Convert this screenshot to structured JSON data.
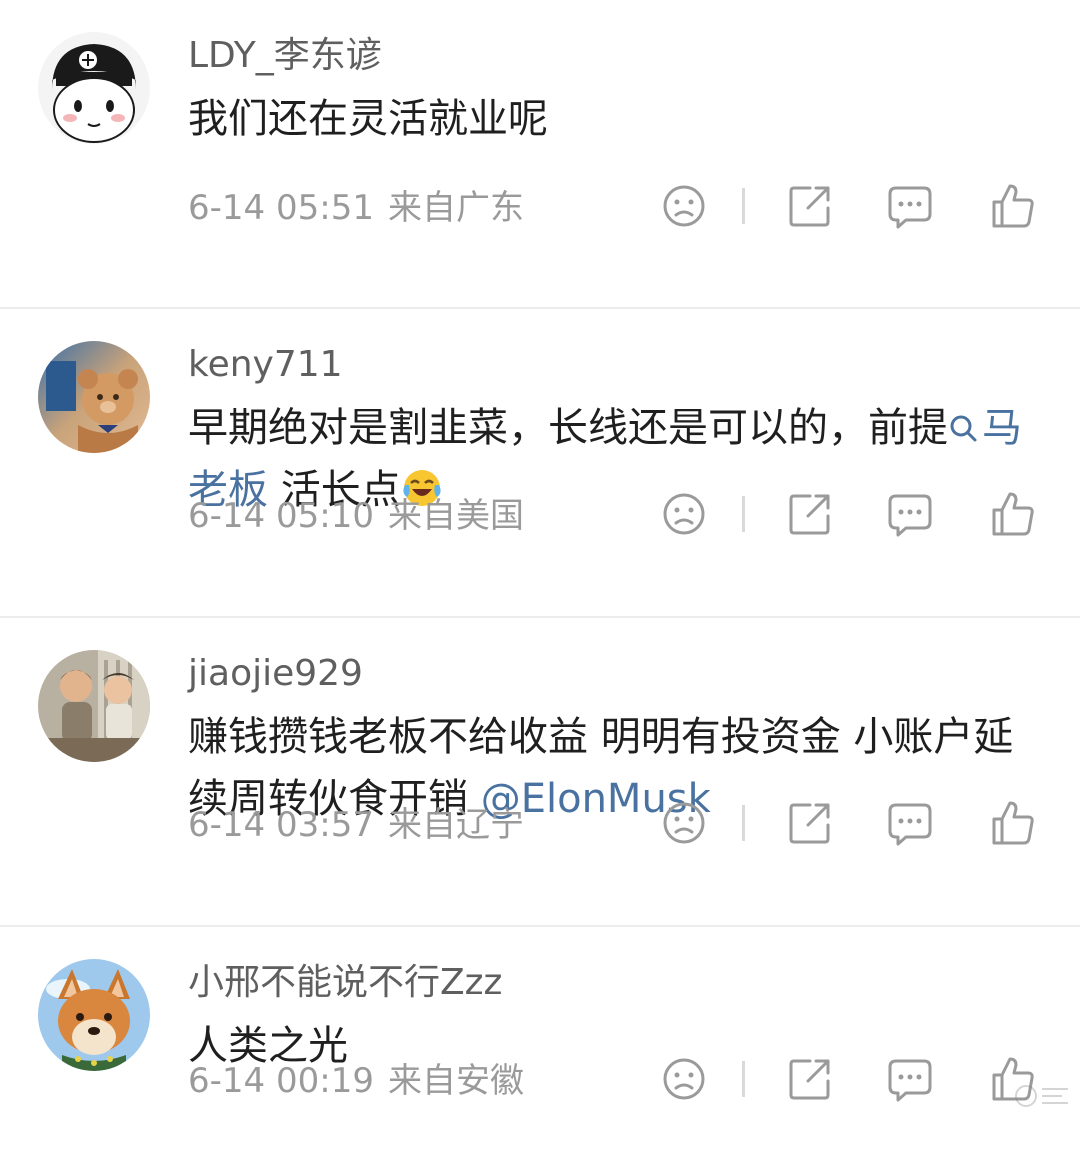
{
  "comments": [
    {
      "username": "LDY_李东谚",
      "content": "我们还在灵活就业呢",
      "time": "6-14 05:51",
      "location": "来自广东",
      "avatar": "cartoon-boy-avatar"
    },
    {
      "username": "keny711",
      "content_before": "早期绝对是割韭菜，长线还是可以的，前提",
      "topic": "马老板",
      "content_after": " 活长点",
      "emoji": "laugh-cry-emoji",
      "time": "6-14 05:10",
      "location": "来自美国",
      "avatar": "teddy-bear-avatar"
    },
    {
      "username": "jiaojie929",
      "content_before": "赚钱攒钱老板不给收益 明明有投资金 小账户延续周转伙食开销 ",
      "mention": "@ElonMusk",
      "time": "6-14 03:57",
      "location": "来自辽宁",
      "avatar": "two-kids-avatar"
    },
    {
      "username": "小邢不能说不行Zzz",
      "content": "人类之光",
      "time": "6-14 00:19",
      "location": "来自安徽",
      "avatar": "shiba-dog-avatar"
    }
  ],
  "action_icons": [
    "dislike-icon",
    "share-icon",
    "reply-icon",
    "like-icon"
  ],
  "colors": {
    "username": "#5f5f5f",
    "content": "#1f1f1f",
    "meta": "#9a9a9a",
    "link": "#4a72a0",
    "divider": "#ececec",
    "icon": "#9a9a9a"
  }
}
